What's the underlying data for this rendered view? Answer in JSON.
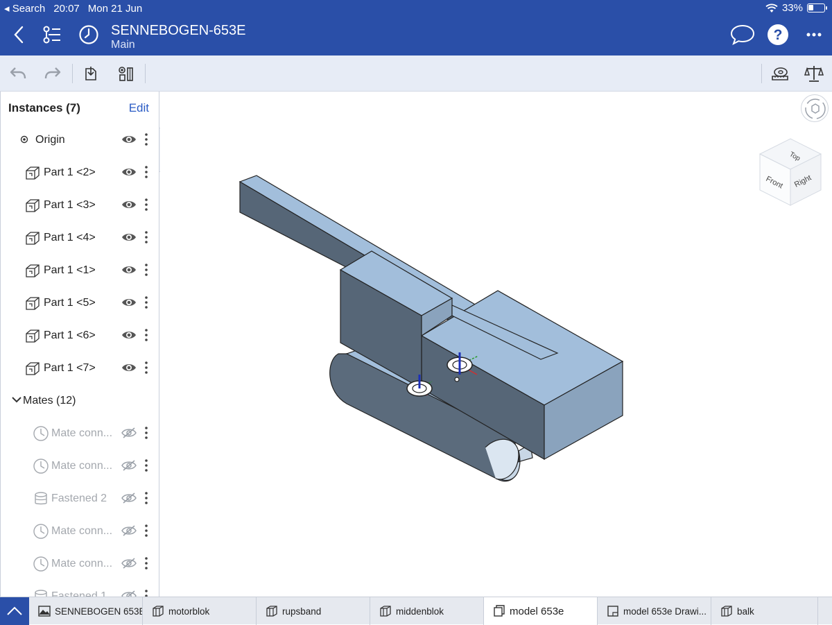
{
  "status": {
    "back_app": "Search",
    "time": "20:07",
    "date": "Mon 21 Jun",
    "battery": "33%",
    "battery_level": 0.33
  },
  "header": {
    "title": "SENNEBOGEN-653E",
    "subtitle": "Main"
  },
  "panel": {
    "title": "Instances (7)",
    "edit": "Edit",
    "origin": "Origin",
    "parts": [
      "Part 1 <2>",
      "Part 1 <3>",
      "Part 1 <4>",
      "Part 1 <1>",
      "Part 1 <5>",
      "Part 1 <6>",
      "Part 1 <7>"
    ],
    "mates_title": "Mates (12)",
    "mates": [
      "Mate conn...",
      "Mate conn...",
      "Fastened 2",
      "Mate conn...",
      "Mate conn...",
      "Fastened 1"
    ]
  },
  "viewcube": {
    "top": "Top",
    "front": "Front",
    "right": "Right"
  },
  "tabs": [
    "SENNEBOGEN 653E",
    "motorblok",
    "rupsband",
    "middenblok",
    "model 653e",
    "model 653e Drawi...",
    "balk"
  ],
  "active_tab": "model 653e",
  "colors": {
    "brand": "#2a4fa8",
    "accent": "#2a5bc4",
    "model_top": "#a2bedb",
    "model_side": "#566677"
  }
}
